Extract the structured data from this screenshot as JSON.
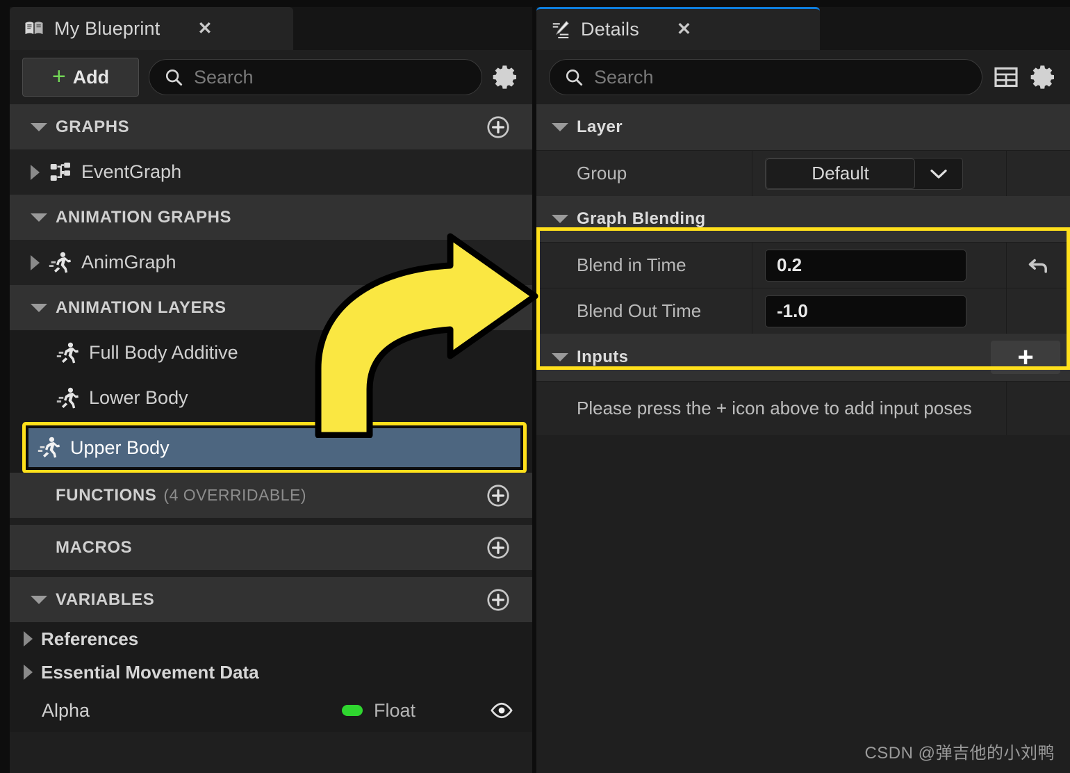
{
  "colors": {
    "accent_yellow": "#ffe01b",
    "selection_blue": "#4d6680",
    "tab_active_blue": "#0e7ddb",
    "add_green": "#72d656",
    "float_green": "#2fd62f",
    "panel_bg": "#1f1f1f",
    "header_row": "#323232"
  },
  "left_panel": {
    "tab": {
      "label": "My Blueprint",
      "icon": "blueprint-book-icon",
      "close": "✕"
    },
    "toolbar": {
      "add_label": "Add",
      "add_plus": "+",
      "search_placeholder": "Search",
      "search_icon": "search-icon",
      "settings_icon": "gear-icon"
    },
    "tree": [
      {
        "id": "graphs",
        "kind": "header",
        "label": "GRAPHS",
        "expander": "down",
        "add": true
      },
      {
        "id": "eventgraph",
        "kind": "item",
        "label": "EventGraph",
        "expander": "right",
        "icon": "event-graph-icon"
      },
      {
        "id": "animation-graphs",
        "kind": "header",
        "label": "ANIMATION GRAPHS",
        "expander": "down",
        "add": false
      },
      {
        "id": "animgraph",
        "kind": "item",
        "label": "AnimGraph",
        "expander": "right",
        "icon": "anim-run-icon"
      },
      {
        "id": "animation-layers",
        "kind": "header",
        "label": "ANIMATION LAYERS",
        "expander": "down",
        "add": true
      },
      {
        "id": "full-body-additive",
        "kind": "leaf",
        "label": "Full Body Additive",
        "icon": "anim-run-icon"
      },
      {
        "id": "lower-body",
        "kind": "leaf",
        "label": "Lower Body",
        "icon": "anim-run-icon"
      },
      {
        "id": "upper-body",
        "kind": "selected",
        "label": "Upper Body",
        "icon": "anim-run-icon"
      },
      {
        "id": "functions",
        "kind": "header",
        "label": "FUNCTIONS",
        "sublabel": "(4 OVERRIDABLE)",
        "add": true
      },
      {
        "id": "macros",
        "kind": "header",
        "label": "MACROS",
        "add": true
      },
      {
        "id": "variables",
        "kind": "header",
        "label": "VARIABLES",
        "expander": "down",
        "add": true
      }
    ],
    "variables": [
      {
        "id": "references",
        "label": "References",
        "expander": "right"
      },
      {
        "id": "essential-movement-data",
        "label": "Essential Movement Data",
        "expander": "right"
      }
    ],
    "alpha_row": {
      "name": "Alpha",
      "type": "Float",
      "type_color": "#2fd62f",
      "visibility_icon": "eye-icon"
    }
  },
  "right_panel": {
    "tab": {
      "label": "Details",
      "icon": "details-pencil-icon",
      "close": "✕"
    },
    "toolbar": {
      "search_placeholder": "Search",
      "search_icon": "search-icon",
      "grid_icon": "table-view-icon",
      "settings_icon": "gear-icon"
    },
    "sections": [
      {
        "id": "layer",
        "title": "Layer",
        "expander": "down",
        "highlighted": false,
        "rows": [
          {
            "id": "group",
            "label": "Group",
            "control": "combo",
            "value": "Default",
            "extra": ""
          }
        ]
      },
      {
        "id": "graph-blending",
        "title": "Graph Blending",
        "expander": "down",
        "highlighted": true,
        "rows": [
          {
            "id": "blend-in-time",
            "label": "Blend in Time",
            "control": "number",
            "value": "0.2",
            "extra": "reset-arrow-icon"
          },
          {
            "id": "blend-out-time",
            "label": "Blend Out Time",
            "control": "number",
            "value": "-1.0",
            "extra": ""
          }
        ]
      },
      {
        "id": "inputs",
        "title": "Inputs",
        "expander": "down",
        "highlighted": false,
        "add_button": "+",
        "hint": "Please press the + icon above to add input poses"
      }
    ]
  },
  "annotation": {
    "arrow": "curved-arrow-right",
    "arrow_color": "#ffe01b",
    "arrow_outline": "#000000"
  },
  "watermark": {
    "text": "CSDN @弹吉他的小刘鸭"
  }
}
